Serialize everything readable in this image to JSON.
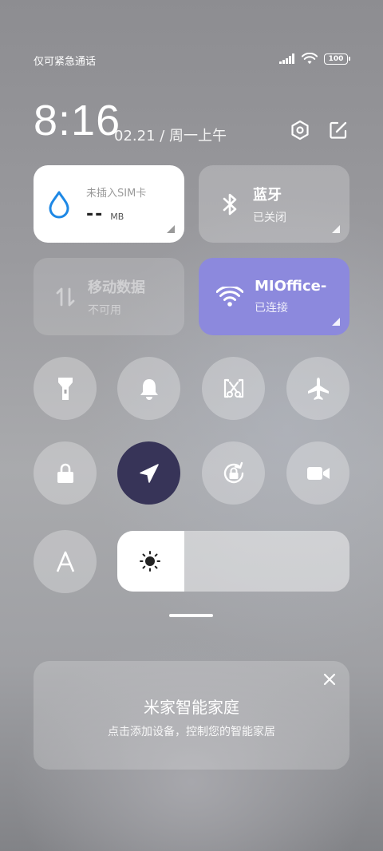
{
  "status": {
    "carrier_text": "仅可紧急通话",
    "battery": "100"
  },
  "header": {
    "time": "8:16",
    "date": "02.21 / 周一上午"
  },
  "tiles": {
    "data": {
      "title": "未插入SIM卡",
      "value": "--",
      "unit": "MB"
    },
    "bluetooth": {
      "title": "蓝牙",
      "status": "已关闭"
    },
    "mobile": {
      "title": "移动数据",
      "status": "不可用"
    },
    "wifi": {
      "title": "MIOffice-",
      "status": "已连接"
    }
  },
  "brightness": {
    "level": 0.29
  },
  "smart_home": {
    "title": "米家智能家庭",
    "subtitle": "点击添加设备，控制您的智能家居"
  },
  "colors": {
    "wifi_tile": "#8c89dd",
    "active_toggle": "#373458",
    "data_icon": "#1e88e5"
  }
}
